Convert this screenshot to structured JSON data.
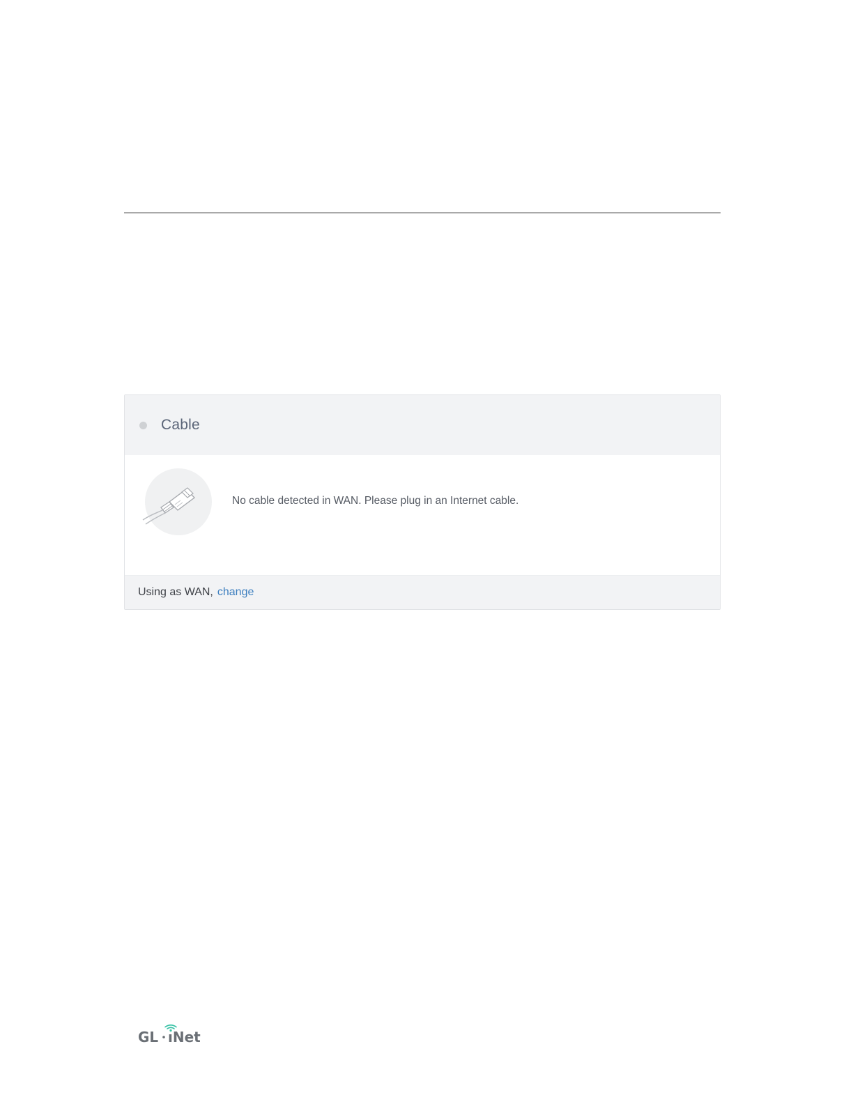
{
  "card": {
    "title": "Cable",
    "status_color": "#cfd1d4",
    "icon": "ethernet-cable-icon",
    "message": "No cable detected in WAN. Please plug in an Internet cable.",
    "footer_text": "Using as WAN,",
    "footer_link": "change",
    "link_color": "#3d7fbf"
  },
  "logo": {
    "text": "GL·iNet",
    "accent_color": "#36c2a5"
  }
}
